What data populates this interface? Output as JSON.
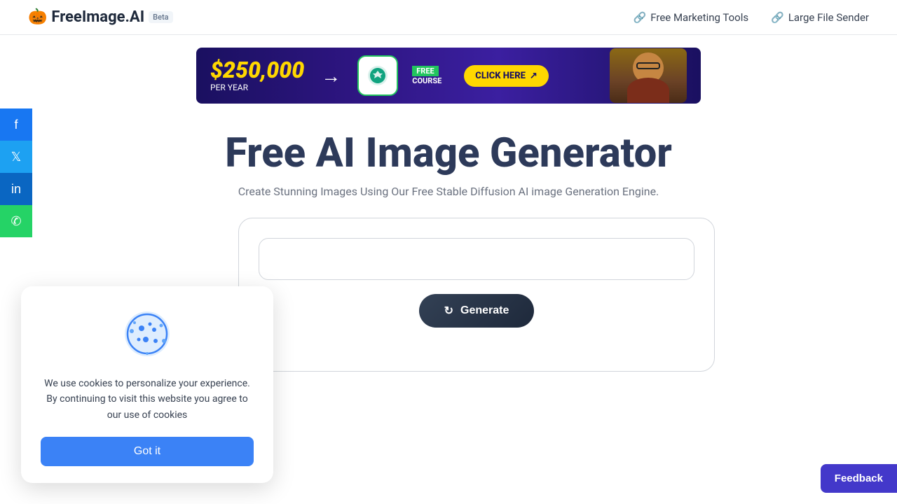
{
  "header": {
    "logo_emoji": "🎃",
    "logo_text": "FreeImage.AI",
    "beta_label": "Beta",
    "nav": {
      "marketing_tools": "Free Marketing Tools",
      "file_sender": "Large File Sender"
    }
  },
  "social": {
    "facebook_label": "f",
    "twitter_label": "t",
    "linkedin_label": "in",
    "whatsapp_label": "w"
  },
  "banner": {
    "amount": "$250,000",
    "per_year": "PER YEAR",
    "click_here": "CLICK HERE",
    "free_label": "FREE",
    "course_label": "COURSE"
  },
  "hero": {
    "title": "Free AI Image Generator",
    "subtitle": "Create Stunning Images Using Our Free Stable Diffusion AI image Generation Engine."
  },
  "generator": {
    "prompt_placeholder": "",
    "generate_label": "Generate"
  },
  "cookie": {
    "message": "We use cookies to personalize your experience. By continuing to visit this website you agree to our use of cookies",
    "button_label": "Got it"
  },
  "feedback": {
    "label": "Feedback"
  }
}
